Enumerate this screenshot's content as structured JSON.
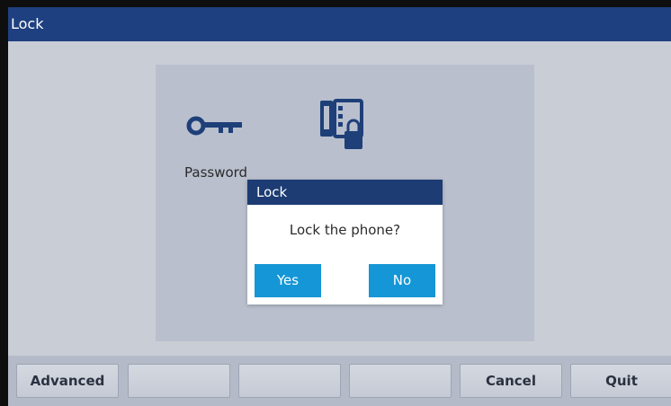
{
  "screen": {
    "title": "Lock",
    "options": [
      {
        "label": "Password",
        "icon": "key-icon"
      },
      {
        "label": "",
        "icon": "phone-lock-icon"
      }
    ]
  },
  "dialog": {
    "title": "Lock",
    "message": "Lock the phone?",
    "yes_label": "Yes",
    "no_label": "No"
  },
  "softkeys": [
    "Advanced",
    "",
    "",
    "",
    "Cancel",
    "Quit"
  ],
  "colors": {
    "title_bar": "#1f4080",
    "dialog_title_bar": "#1c3c73",
    "button_blue": "#1596d6",
    "icon_navy": "#1e3f78"
  }
}
